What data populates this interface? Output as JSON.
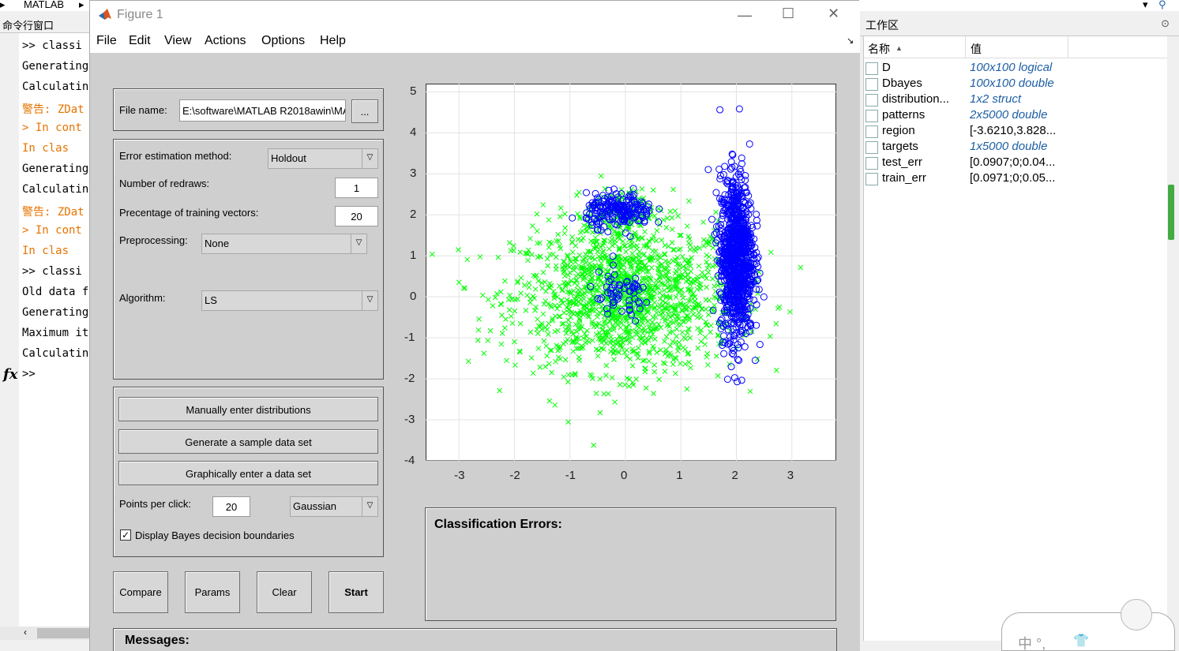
{
  "matlab": {
    "breadcrumb": "MATLAB",
    "command_window_title": "命令行窗口",
    "workspace_title": "工作区",
    "command_lines": [
      {
        "text": ">> classi",
        "style": "normal"
      },
      {
        "text": "Generating",
        "style": "normal"
      },
      {
        "text": "Calculatin",
        "style": "normal"
      },
      {
        "text": "警告: ZDat",
        "style": "warn"
      },
      {
        "text": "> In cont",
        "style": "warn"
      },
      {
        "text": "  In clas",
        "style": "warn"
      },
      {
        "text": "Generating",
        "style": "normal"
      },
      {
        "text": "Calculatin",
        "style": "normal"
      },
      {
        "text": "警告: ZDat",
        "style": "warn"
      },
      {
        "text": "> In cont",
        "style": "warn"
      },
      {
        "text": "  In clas",
        "style": "warn"
      },
      {
        "text": ">>  classi",
        "style": "normal"
      },
      {
        "text": "Old data f",
        "style": "normal"
      },
      {
        "text": "Generating",
        "style": "normal"
      },
      {
        "text": "Maximum it",
        "style": "normal"
      },
      {
        "text": "Calculatin",
        "style": "normal"
      },
      {
        "text": ">>",
        "style": "normal"
      }
    ],
    "fx": "fx"
  },
  "workspace": {
    "col_name": "名称",
    "col_value": "值",
    "rows": [
      {
        "name": "D",
        "value": "100x100 logical",
        "italic": true
      },
      {
        "name": "Dbayes",
        "value": "100x100 double",
        "italic": true
      },
      {
        "name": "distribution...",
        "value": "1x2 struct",
        "italic": true
      },
      {
        "name": "patterns",
        "value": "2x5000 double",
        "italic": true
      },
      {
        "name": "region",
        "value": "[-3.6210,3.828...",
        "italic": false
      },
      {
        "name": "targets",
        "value": "1x5000 double",
        "italic": true
      },
      {
        "name": "test_err",
        "value": "[0.0907;0;0.04...",
        "italic": false
      },
      {
        "name": "train_err",
        "value": "[0.0971;0;0.05...",
        "italic": false
      }
    ]
  },
  "figure": {
    "title": "Figure 1",
    "menu": [
      "File",
      "Edit",
      "View",
      "Actions",
      "Options",
      "Help"
    ],
    "file_name_label": "File name:",
    "file_name_value": "E:\\software\\MATLAB R2018awin\\MA",
    "browse_label": "...",
    "error_method_label": "Error estimation method:",
    "error_method_value": "Holdout",
    "redraws_label": "Number of redraws:",
    "redraws_value": "1",
    "training_label": "Precentage of training vectors:",
    "training_value": "20",
    "preprocessing_label": "Preprocessing:",
    "preprocessing_value": "None",
    "algorithm_label": "Algorithm:",
    "algorithm_value": "LS",
    "btn_manual": "Manually enter distributions",
    "btn_generate": "Generate a sample data set",
    "btn_graphical": "Graphically enter a data set",
    "points_label": "Points per click:",
    "points_value": "20",
    "distribution_value": "Gaussian",
    "bayes_checkbox_label": "Display Bayes decision boundaries",
    "bayes_checked": true,
    "btn_compare": "Compare",
    "btn_params": "Params",
    "btn_clear": "Clear",
    "btn_start": "Start",
    "class_errors_title": "Classification Errors:",
    "messages_title": "Messages:"
  },
  "ime": {
    "text": "中 °,"
  },
  "chart_data": {
    "type": "scatter",
    "xlim": [
      -3.6,
      3.8
    ],
    "ylim": [
      -4,
      5.2
    ],
    "xticks": [
      -3,
      -2,
      -1,
      0,
      1,
      2,
      3
    ],
    "yticks": [
      -4,
      -3,
      -2,
      -1,
      0,
      1,
      2,
      3,
      4,
      5
    ],
    "grid": true,
    "series": [
      {
        "marker": "x",
        "color": "#00ff00",
        "clusters": [
          {
            "cx": 0.0,
            "cy": 0.0,
            "sx": 1.0,
            "sy": 0.9,
            "n": 1500
          },
          {
            "cx": -0.1,
            "cy": 2.0,
            "sx": 0.3,
            "sy": 0.3,
            "n": 150
          }
        ]
      },
      {
        "marker": "o",
        "color": "#0000ff",
        "clusters": [
          {
            "cx": 2.0,
            "cy": 1.0,
            "sx": 0.15,
            "sy": 1.0,
            "n": 1000
          },
          {
            "cx": -0.1,
            "cy": 2.1,
            "sx": 0.3,
            "sy": 0.2,
            "n": 200
          },
          {
            "cx": -0.1,
            "cy": 0.0,
            "sx": 0.3,
            "sy": 0.3,
            "n": 60
          }
        ]
      }
    ]
  }
}
